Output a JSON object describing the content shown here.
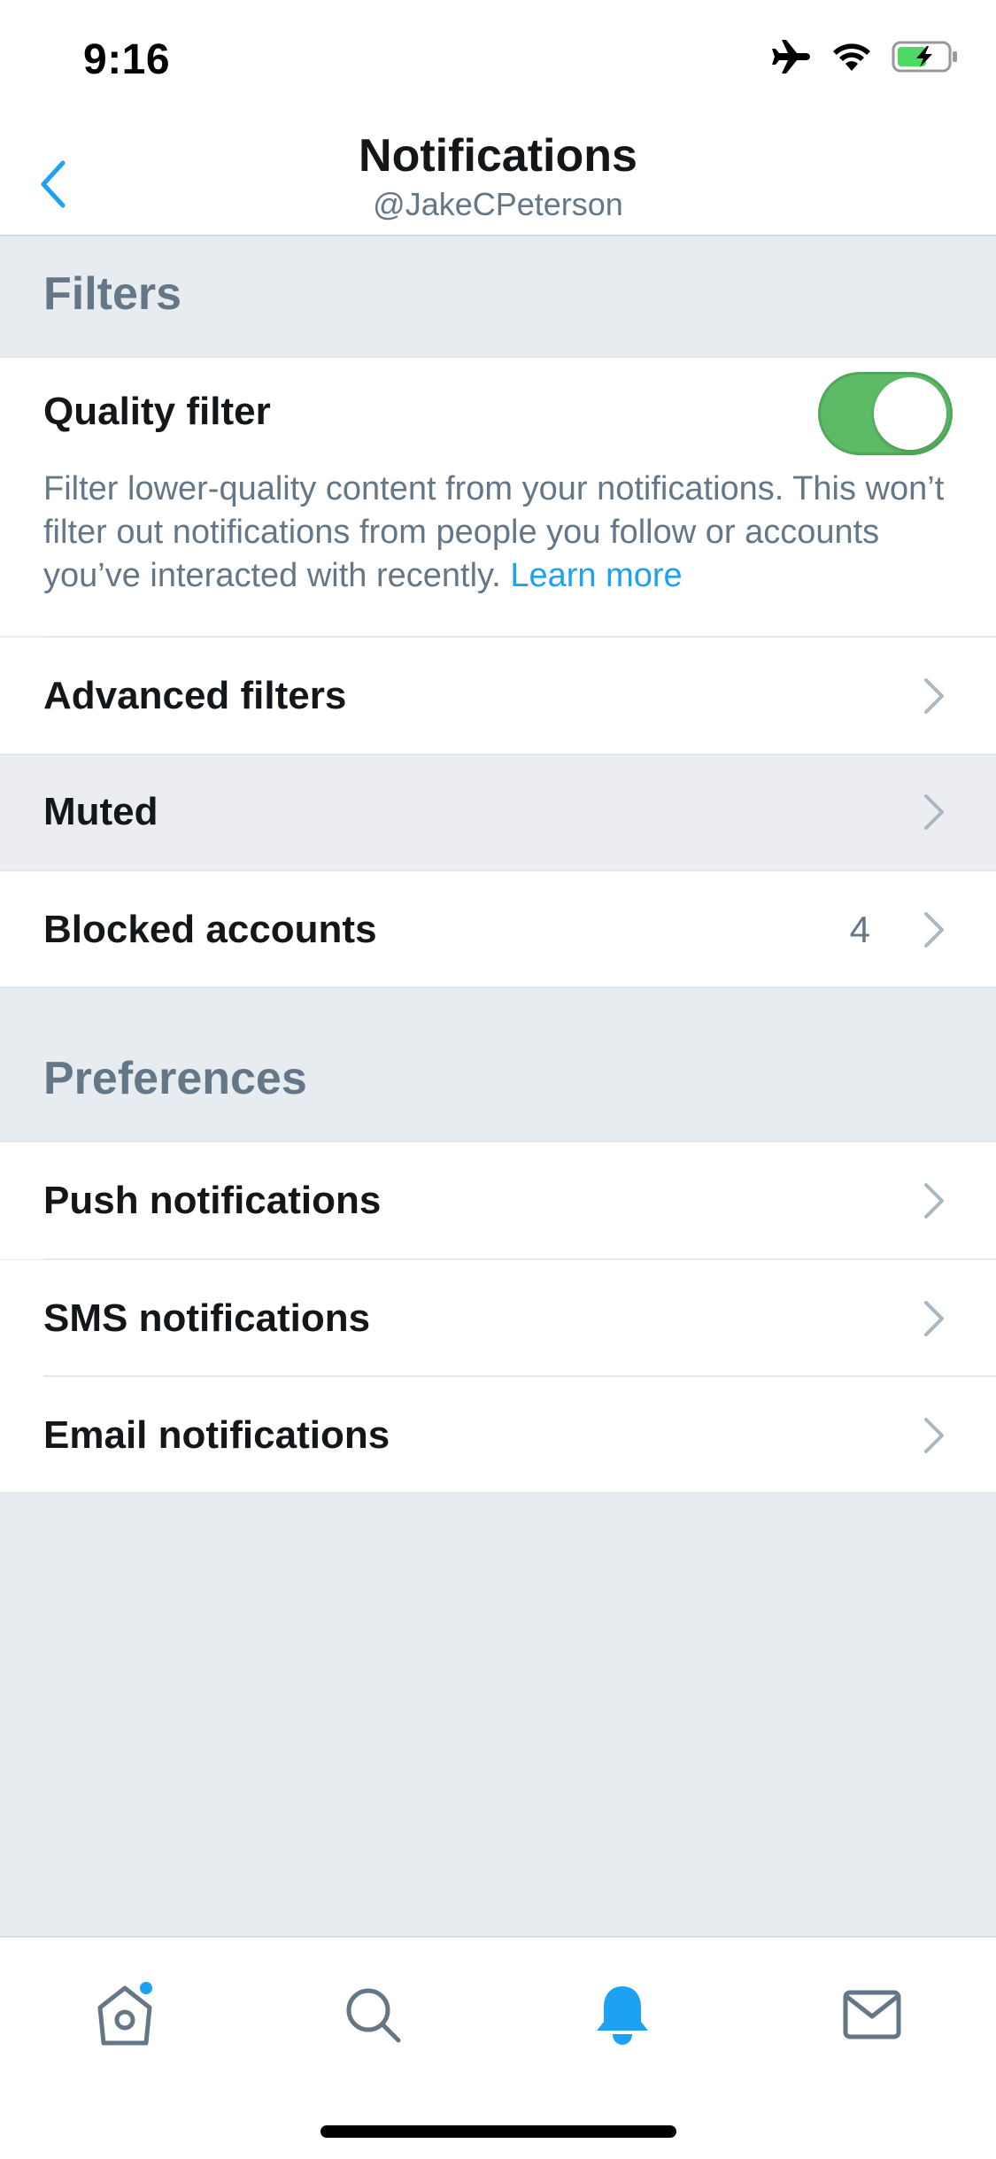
{
  "status_bar": {
    "time": "9:16",
    "icons": [
      "airplane-icon",
      "wifi-icon",
      "battery-charging-icon"
    ]
  },
  "nav": {
    "title": "Notifications",
    "subtitle": "@JakeCPeterson",
    "back_icon": "chevron-left-icon"
  },
  "filters": {
    "header": "Filters",
    "quality_filter": {
      "label": "Quality filter",
      "enabled": true,
      "description": "Filter lower-quality content from your notifications. This won’t filter out notifications from people you follow or accounts you’ve interacted with recently.",
      "link": "Learn more"
    },
    "advanced_filters": "Advanced filters",
    "muted": "Muted",
    "blocked_accounts": "Blocked accounts",
    "blocked_count": "4"
  },
  "preferences": {
    "header": "Preferences",
    "push": "Push notifications",
    "sms": "SMS notifications",
    "email": "Email notifications"
  },
  "tab_bar": {
    "tabs": [
      "home-icon",
      "search-icon",
      "notifications-icon",
      "messages-icon"
    ],
    "active": "notifications-icon"
  },
  "colors": {
    "accent": "#1da1f2",
    "toggle_on": "#5dbb67",
    "secondary_text": "#657786",
    "background": "#e6ecf0"
  }
}
